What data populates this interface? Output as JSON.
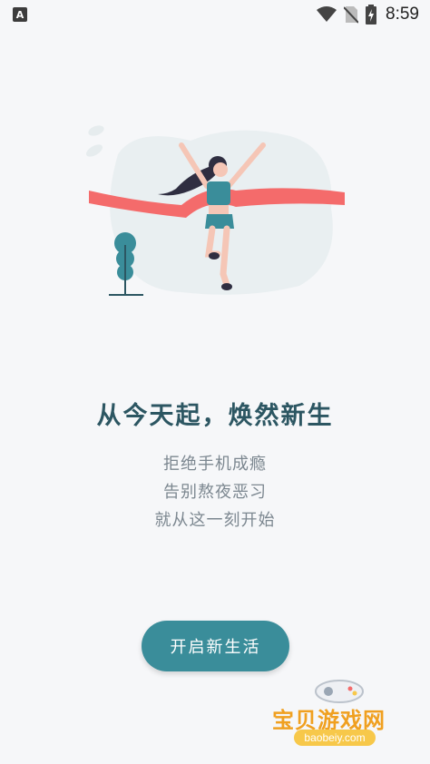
{
  "status_bar": {
    "left_icon_letter": "A",
    "time": "8:59"
  },
  "onboarding": {
    "headline": "从今天起，焕然新生",
    "lines": [
      "拒绝手机成瘾",
      "告别熬夜恶习",
      "就从这一刻开始"
    ],
    "cta_label": "开启新生活"
  },
  "watermark": {
    "title": "宝贝游戏网",
    "url": "baobeiy.com"
  },
  "colors": {
    "background": "#f6f7f9",
    "accent": "#3a8d9a",
    "headline": "#2c5662",
    "subtitle": "#7c8790",
    "ribbon": "#f46b6b"
  }
}
